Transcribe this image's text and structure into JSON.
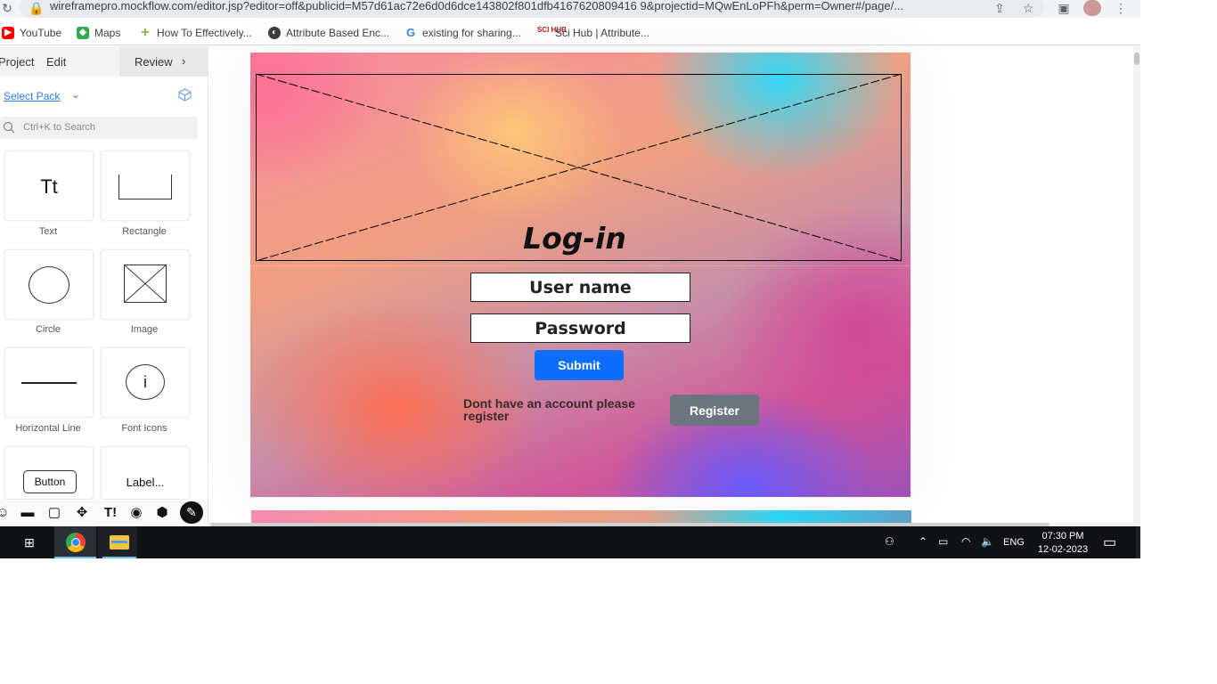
{
  "browser": {
    "url": "wireframepro.mockflow.com/editor.jsp?editor=off&publicid=M57d61ac72e6d0d6dce143802f801dfb4167620809416 9&projectid=MQwEnLoPFh&perm=Owner#/page/...",
    "bookmarks": [
      {
        "label": "YouTube",
        "icon": "youtube-icon",
        "color": "#ff0000"
      },
      {
        "label": "Maps",
        "icon": "maps-icon",
        "color": "#34a853"
      },
      {
        "label": "How To Effectively...",
        "icon": "plus-icon",
        "color": "#7cb342"
      },
      {
        "label": "Attribute Based Enc...",
        "icon": "globe-icon",
        "color": "#3c4043"
      },
      {
        "label": "existing for sharing...",
        "icon": "google-icon",
        "color": "#4285f4"
      },
      {
        "label": "Sci Hub | Attribute...",
        "icon": "scihub-icon",
        "color": "#b71c1c"
      }
    ]
  },
  "editor": {
    "menu": {
      "project": "Project",
      "edit": "Edit",
      "review": "Review"
    },
    "select_pack": "Select Pack",
    "search_placeholder": "Ctrl+K to Search",
    "components": [
      {
        "label": "Text"
      },
      {
        "label": "Rectangle"
      },
      {
        "label": "Circle"
      },
      {
        "label": "Image"
      },
      {
        "label": "Horizontal Line"
      },
      {
        "label": "Font Icons"
      },
      {
        "label": "Button"
      },
      {
        "label": "Label..."
      }
    ],
    "tile_text": {
      "text": "Tt",
      "button": "Button",
      "label": "Label...",
      "info": "i"
    }
  },
  "canvas": {
    "title": "Log-in",
    "username_field": "User name",
    "password_field": "Password",
    "submit_label": "Submit",
    "no_account_text": "Dont have an account  please register",
    "register_label": "Register",
    "colors": {
      "submit": "#0d6efd",
      "register": "#6c757d"
    }
  },
  "taskbar": {
    "language": "ENG",
    "time": "07:30 PM",
    "date": "12-02-2023"
  }
}
